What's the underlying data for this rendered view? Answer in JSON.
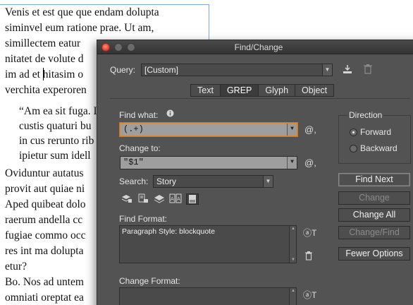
{
  "document": {
    "lines": [
      "Venis et est que que endam dolupta",
      "siminvel eum ratione prae. Ut am,",
      "simillectem eatur",
      "nitatet de volute d",
      "im ad et hitasim o",
      "verchita experoren"
    ],
    "quote_lines": [
      "“Am ea sit fuga. I",
      "custis quaturi bu",
      "in cus rerunto rib",
      "ipietur sum idell"
    ],
    "after_lines": [
      "Oviduntur autatus",
      "provit aut quiae ni",
      "Aped quibeat dolo",
      "raerum andella cc",
      "fugiae commo occ",
      "res int ma dolupta",
      "etur?",
      "Bo. Nos ad untem",
      "omniati oreptat ea"
    ]
  },
  "dialog": {
    "title": "Find/Change",
    "query_label": "Query:",
    "query_value": "[Custom]",
    "tabs": [
      {
        "label": "Text",
        "active": false
      },
      {
        "label": "GREP",
        "active": true
      },
      {
        "label": "Glyph",
        "active": false
      },
      {
        "label": "Object",
        "active": false
      }
    ],
    "find_what_label": "Find what:",
    "find_what_value": "(.+)",
    "change_to_label": "Change to:",
    "change_to_value": "\"$1\"",
    "search_label": "Search:",
    "search_value": "Story",
    "find_format_label": "Find Format:",
    "find_format_value": "Paragraph Style: blockquote",
    "change_format_label": "Change Format:",
    "direction": {
      "title": "Direction",
      "options": [
        {
          "label": "Forward",
          "selected": true
        },
        {
          "label": "Backward",
          "selected": false
        }
      ]
    },
    "buttons": {
      "find_next": "Find Next",
      "change": "Change",
      "change_all": "Change All",
      "change_find": "Change/Find",
      "fewer_options": "Fewer Options"
    },
    "icons": {
      "at": "@,",
      "format_search": "ⓐT"
    }
  }
}
